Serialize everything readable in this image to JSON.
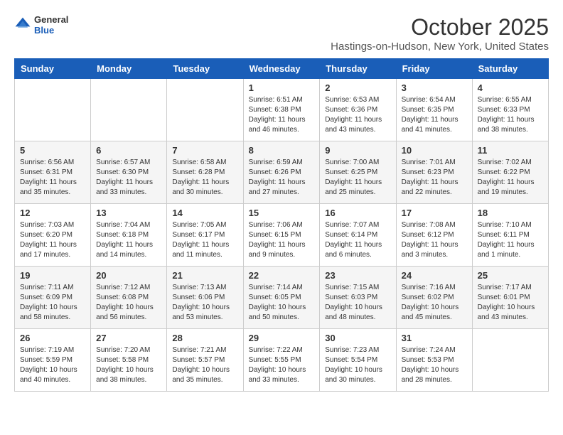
{
  "header": {
    "logo_general": "General",
    "logo_blue": "Blue",
    "month_title": "October 2025",
    "location": "Hastings-on-Hudson, New York, United States"
  },
  "weekdays": [
    "Sunday",
    "Monday",
    "Tuesday",
    "Wednesday",
    "Thursday",
    "Friday",
    "Saturday"
  ],
  "weeks": [
    [
      {
        "day": "",
        "info": ""
      },
      {
        "day": "",
        "info": ""
      },
      {
        "day": "",
        "info": ""
      },
      {
        "day": "1",
        "info": "Sunrise: 6:51 AM\nSunset: 6:38 PM\nDaylight: 11 hours\nand 46 minutes."
      },
      {
        "day": "2",
        "info": "Sunrise: 6:53 AM\nSunset: 6:36 PM\nDaylight: 11 hours\nand 43 minutes."
      },
      {
        "day": "3",
        "info": "Sunrise: 6:54 AM\nSunset: 6:35 PM\nDaylight: 11 hours\nand 41 minutes."
      },
      {
        "day": "4",
        "info": "Sunrise: 6:55 AM\nSunset: 6:33 PM\nDaylight: 11 hours\nand 38 minutes."
      }
    ],
    [
      {
        "day": "5",
        "info": "Sunrise: 6:56 AM\nSunset: 6:31 PM\nDaylight: 11 hours\nand 35 minutes."
      },
      {
        "day": "6",
        "info": "Sunrise: 6:57 AM\nSunset: 6:30 PM\nDaylight: 11 hours\nand 33 minutes."
      },
      {
        "day": "7",
        "info": "Sunrise: 6:58 AM\nSunset: 6:28 PM\nDaylight: 11 hours\nand 30 minutes."
      },
      {
        "day": "8",
        "info": "Sunrise: 6:59 AM\nSunset: 6:26 PM\nDaylight: 11 hours\nand 27 minutes."
      },
      {
        "day": "9",
        "info": "Sunrise: 7:00 AM\nSunset: 6:25 PM\nDaylight: 11 hours\nand 25 minutes."
      },
      {
        "day": "10",
        "info": "Sunrise: 7:01 AM\nSunset: 6:23 PM\nDaylight: 11 hours\nand 22 minutes."
      },
      {
        "day": "11",
        "info": "Sunrise: 7:02 AM\nSunset: 6:22 PM\nDaylight: 11 hours\nand 19 minutes."
      }
    ],
    [
      {
        "day": "12",
        "info": "Sunrise: 7:03 AM\nSunset: 6:20 PM\nDaylight: 11 hours\nand 17 minutes."
      },
      {
        "day": "13",
        "info": "Sunrise: 7:04 AM\nSunset: 6:18 PM\nDaylight: 11 hours\nand 14 minutes."
      },
      {
        "day": "14",
        "info": "Sunrise: 7:05 AM\nSunset: 6:17 PM\nDaylight: 11 hours\nand 11 minutes."
      },
      {
        "day": "15",
        "info": "Sunrise: 7:06 AM\nSunset: 6:15 PM\nDaylight: 11 hours\nand 9 minutes."
      },
      {
        "day": "16",
        "info": "Sunrise: 7:07 AM\nSunset: 6:14 PM\nDaylight: 11 hours\nand 6 minutes."
      },
      {
        "day": "17",
        "info": "Sunrise: 7:08 AM\nSunset: 6:12 PM\nDaylight: 11 hours\nand 3 minutes."
      },
      {
        "day": "18",
        "info": "Sunrise: 7:10 AM\nSunset: 6:11 PM\nDaylight: 11 hours\nand 1 minute."
      }
    ],
    [
      {
        "day": "19",
        "info": "Sunrise: 7:11 AM\nSunset: 6:09 PM\nDaylight: 10 hours\nand 58 minutes."
      },
      {
        "day": "20",
        "info": "Sunrise: 7:12 AM\nSunset: 6:08 PM\nDaylight: 10 hours\nand 56 minutes."
      },
      {
        "day": "21",
        "info": "Sunrise: 7:13 AM\nSunset: 6:06 PM\nDaylight: 10 hours\nand 53 minutes."
      },
      {
        "day": "22",
        "info": "Sunrise: 7:14 AM\nSunset: 6:05 PM\nDaylight: 10 hours\nand 50 minutes."
      },
      {
        "day": "23",
        "info": "Sunrise: 7:15 AM\nSunset: 6:03 PM\nDaylight: 10 hours\nand 48 minutes."
      },
      {
        "day": "24",
        "info": "Sunrise: 7:16 AM\nSunset: 6:02 PM\nDaylight: 10 hours\nand 45 minutes."
      },
      {
        "day": "25",
        "info": "Sunrise: 7:17 AM\nSunset: 6:01 PM\nDaylight: 10 hours\nand 43 minutes."
      }
    ],
    [
      {
        "day": "26",
        "info": "Sunrise: 7:19 AM\nSunset: 5:59 PM\nDaylight: 10 hours\nand 40 minutes."
      },
      {
        "day": "27",
        "info": "Sunrise: 7:20 AM\nSunset: 5:58 PM\nDaylight: 10 hours\nand 38 minutes."
      },
      {
        "day": "28",
        "info": "Sunrise: 7:21 AM\nSunset: 5:57 PM\nDaylight: 10 hours\nand 35 minutes."
      },
      {
        "day": "29",
        "info": "Sunrise: 7:22 AM\nSunset: 5:55 PM\nDaylight: 10 hours\nand 33 minutes."
      },
      {
        "day": "30",
        "info": "Sunrise: 7:23 AM\nSunset: 5:54 PM\nDaylight: 10 hours\nand 30 minutes."
      },
      {
        "day": "31",
        "info": "Sunrise: 7:24 AM\nSunset: 5:53 PM\nDaylight: 10 hours\nand 28 minutes."
      },
      {
        "day": "",
        "info": ""
      }
    ]
  ]
}
